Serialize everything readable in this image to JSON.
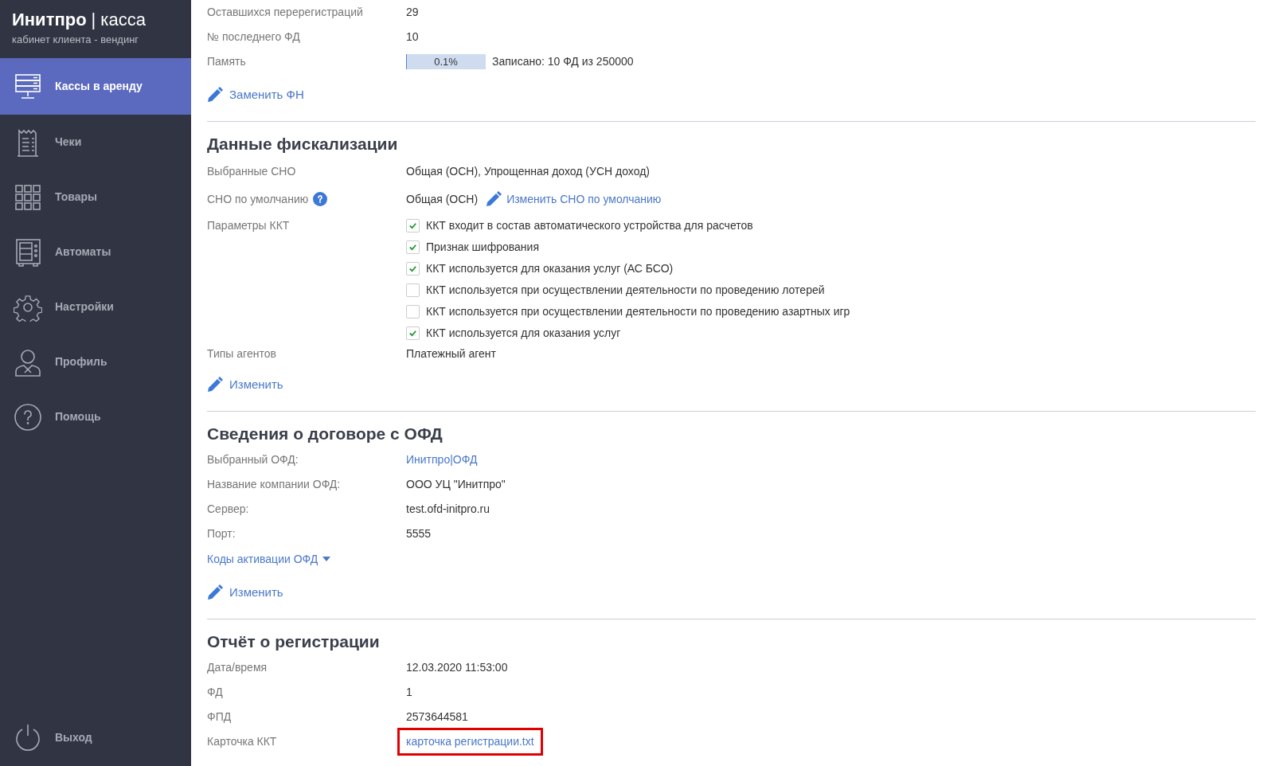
{
  "brand": {
    "name": "Инитпро",
    "separator": "|",
    "product": "касса",
    "subtitle": "кабинет клиента - вендинг"
  },
  "sidebar": {
    "items": [
      {
        "label": "Кассы в аренду",
        "selected": true
      },
      {
        "label": "Чеки",
        "selected": false
      },
      {
        "label": "Товары",
        "selected": false
      },
      {
        "label": "Автоматы",
        "selected": false
      },
      {
        "label": "Настройки",
        "selected": false
      },
      {
        "label": "Профиль",
        "selected": false
      },
      {
        "label": "Помощь",
        "selected": false
      }
    ],
    "logout": {
      "label": "Выход"
    }
  },
  "fn_section": {
    "rows": [
      {
        "kind": "text",
        "label": "Оставшихся перерегистраций",
        "value": "29"
      },
      {
        "kind": "text",
        "label": "№ последнего ФД",
        "value": "10"
      },
      {
        "kind": "meter",
        "label": "Память",
        "reading": "0.1%",
        "level": 0.001,
        "note": "Записано: 10 ФД из 250000"
      }
    ],
    "action": "Заменить ФН"
  },
  "fiscal_section": {
    "title": "Данные фискализации",
    "selected_tax": {
      "label": "Выбранные СНО",
      "value": "Общая (ОСН), Упрощенная доход (УСН доход)"
    },
    "default_tax": {
      "label": "СНО по умолчанию",
      "value": "Общая (ОСН)",
      "action": "Изменить СНО по умолчанию"
    },
    "params": {
      "label": "Параметры ККТ",
      "options": [
        {
          "label": "ККТ входит в состав автоматического устройства для расчетов",
          "checked": true
        },
        {
          "label": "Признак шифрования",
          "checked": true
        },
        {
          "label": "ККТ используется для оказания услуг (АС БСО)",
          "checked": true
        },
        {
          "label": "ККТ используется при осуществлении деятельности по проведению лотерей",
          "checked": false
        },
        {
          "label": "ККТ используется при осуществлении деятельности по проведению азартных игр",
          "checked": false
        },
        {
          "label": "ККТ используется для оказания услуг",
          "checked": true
        }
      ]
    },
    "agents": {
      "label": "Типы агентов",
      "value": "Платежный агент"
    },
    "action": "Изменить"
  },
  "ofd_section": {
    "title": "Сведения о договоре с ОФД",
    "rows": [
      {
        "kind": "link",
        "label": "Выбранный ОФД:",
        "value": "Инитпро|ОФД"
      },
      {
        "kind": "text",
        "label": "Название компании ОФД:",
        "value": "ООО УЦ \"Инитпро\""
      },
      {
        "kind": "text",
        "label": "Сервер:",
        "value": "test.ofd-initpro.ru"
      },
      {
        "kind": "text",
        "label": "Порт:",
        "value": "5555"
      }
    ],
    "codes_toggle": {
      "label": "Коды активации ОФД",
      "expanded": false
    },
    "action": "Изменить"
  },
  "report_section": {
    "title": "Отчёт о регистрации",
    "rows": [
      {
        "kind": "text",
        "label": "Дата/время",
        "value": "12.03.2020 11:53:00"
      },
      {
        "kind": "text",
        "label": "ФД",
        "value": "1"
      },
      {
        "kind": "text",
        "label": "ФПД",
        "value": "2573644581"
      },
      {
        "kind": "link",
        "label": "Карточка ККТ",
        "value": "карточка регистрации.txt",
        "highlighted": true
      }
    ]
  }
}
